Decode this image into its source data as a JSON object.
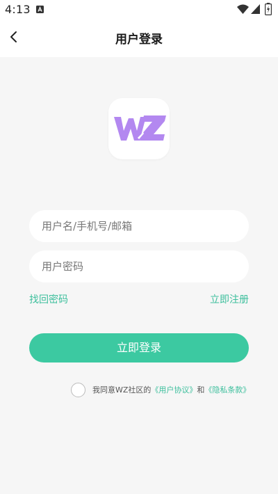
{
  "status_bar": {
    "time": "4:13",
    "icons": [
      "notification-a-icon",
      "wifi-icon",
      "signal-icon",
      "battery-icon"
    ]
  },
  "header": {
    "title": "用户登录",
    "back_icon": "back-arrow-icon"
  },
  "logo": {
    "text": "WZ",
    "color": "#b388f0"
  },
  "form": {
    "username_placeholder": "用户名/手机号/邮箱",
    "password_placeholder": "用户密码",
    "forgot_password": "找回密码",
    "register": "立即注册",
    "login_button": "立即登录"
  },
  "agreement": {
    "prefix": "我同意WZ社区的",
    "user_agreement": "《用户协议》",
    "and": "和",
    "privacy_policy": "《隐私条款》",
    "checked": false
  },
  "colors": {
    "accent": "#3cc9a1",
    "link": "#3cbf9c",
    "background": "#f6f6f6",
    "logo_purple": "#b388f0"
  }
}
